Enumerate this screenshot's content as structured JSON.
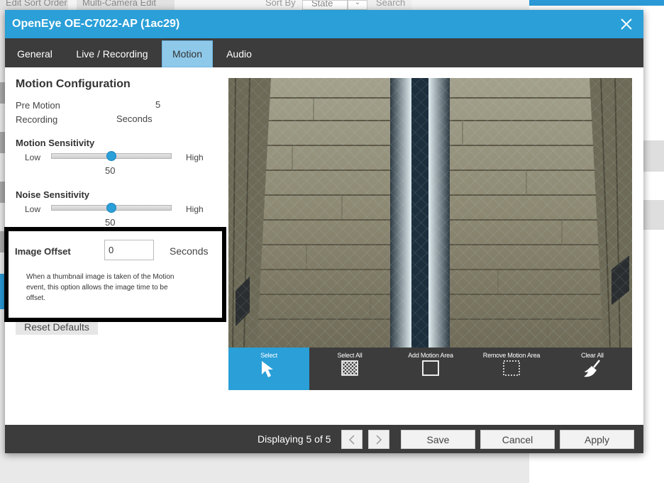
{
  "background": {
    "toolbar_left": "Edit Sort Order",
    "toolbar_middle": "Multi-Camera Edit",
    "sort_by_label": "Sort By",
    "sort_by_value": "State",
    "search_label": "Search"
  },
  "dialog": {
    "title": "OpenEye OE-C7022-AP (1ac29)",
    "tabs": [
      {
        "label": "General"
      },
      {
        "label": "Live / Recording"
      },
      {
        "label": "Motion",
        "active": true
      },
      {
        "label": "Audio"
      }
    ]
  },
  "motion": {
    "section_title": "Motion Configuration",
    "pre_motion_label": "Pre Motion Recording",
    "pre_motion_value": "5",
    "pre_motion_unit": "Seconds",
    "motion_sensitivity": {
      "title": "Motion Sensitivity",
      "low": "Low",
      "high": "High",
      "value": 50,
      "value_text": "50",
      "min": 0,
      "max": 100
    },
    "noise_sensitivity": {
      "title": "Noise Sensitivity",
      "low": "Low",
      "high": "High",
      "value": 50,
      "value_text": "50",
      "min": 0,
      "max": 100
    },
    "image_offset": {
      "label": "Image Offset",
      "value": "0",
      "unit": "Seconds",
      "help": "When a thumbnail image is taken of the Motion event, this option allows the image time to be offset."
    },
    "reset_label": "Reset Defaults"
  },
  "tools": [
    {
      "label": "Select",
      "icon": "cursor-arrow-icon",
      "active": true
    },
    {
      "label": "Select All",
      "icon": "grid-select-all-icon"
    },
    {
      "label": "Add Motion Area",
      "icon": "square-outline-icon"
    },
    {
      "label": "Remove Motion Area",
      "icon": "dashed-square-icon"
    },
    {
      "label": "Clear All",
      "icon": "broom-icon"
    }
  ],
  "footer": {
    "displaying": "Displaying 5 of 5",
    "save_label": "Save",
    "cancel_label": "Cancel",
    "apply_label": "Apply"
  },
  "colors": {
    "accent": "#2a9fd8",
    "dark_bar": "#3c3c3c",
    "active_tab": "#8fc9ea"
  }
}
